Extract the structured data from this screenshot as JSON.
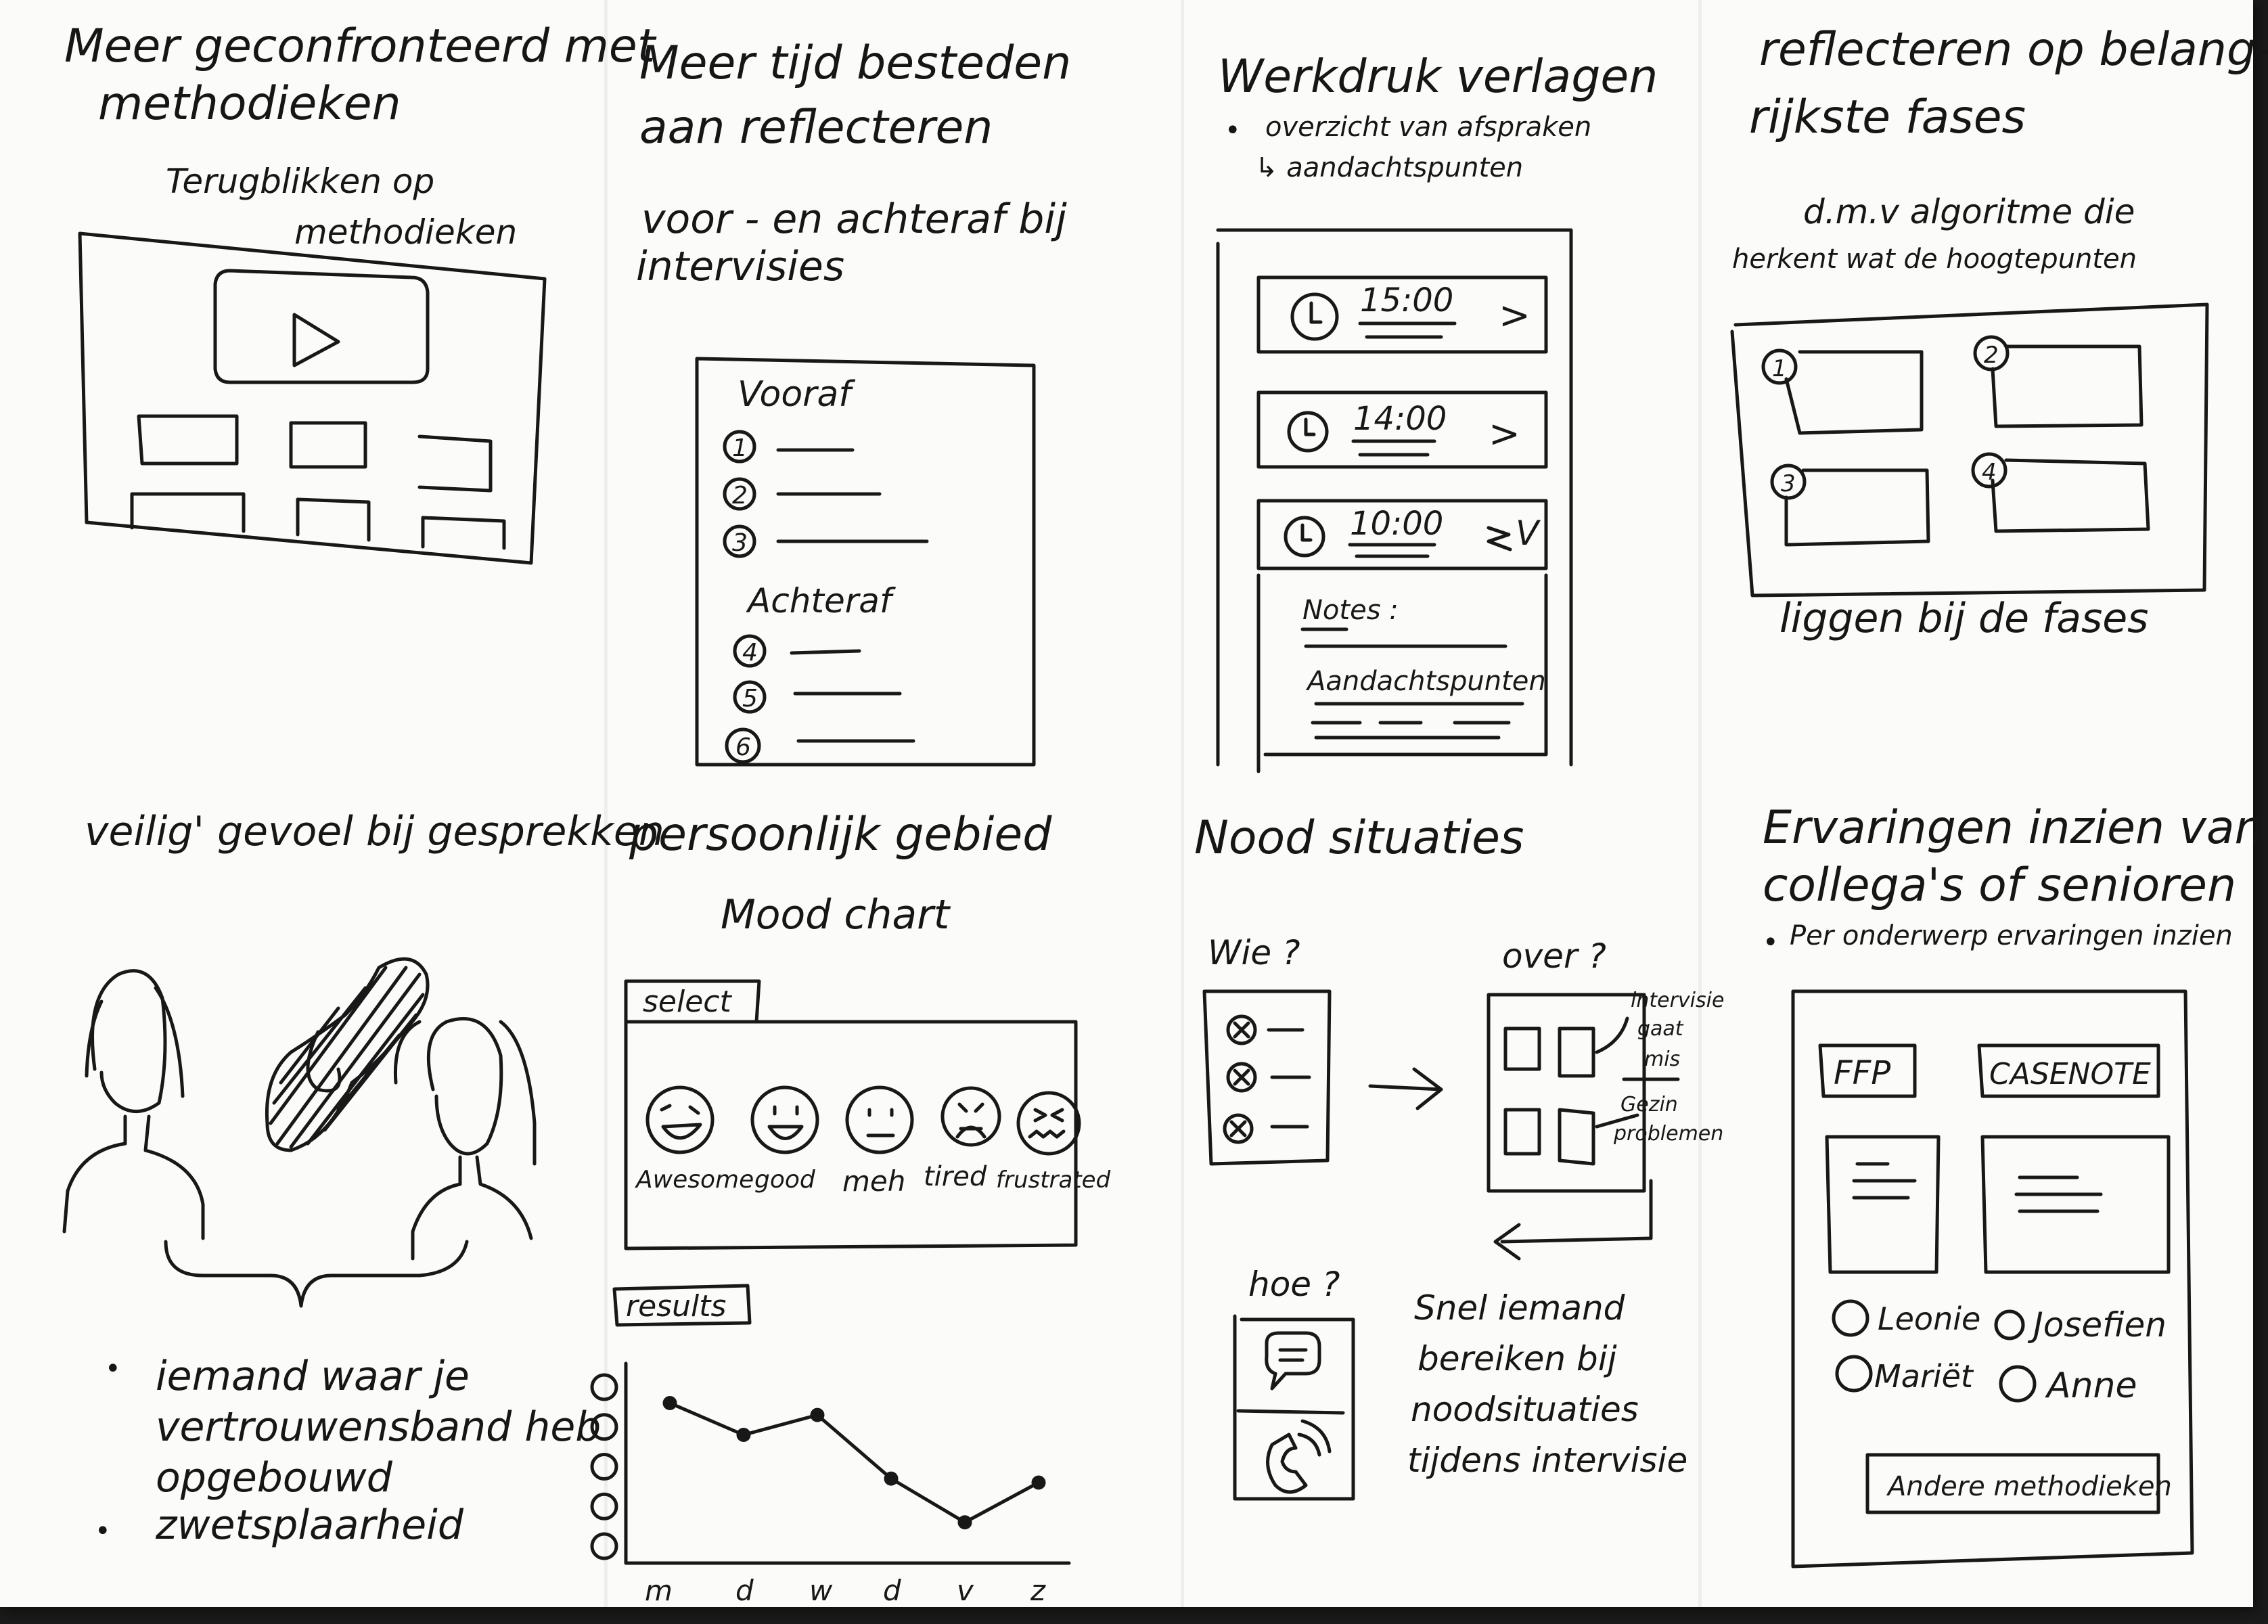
{
  "panels": {
    "p1": {
      "title_line1": "Meer geconfronteerd met",
      "title_line2": "methodieken",
      "subtitle_line1": "Terugblikken op",
      "subtitle_line2": "methodieken"
    },
    "p2": {
      "title_line1": "Meer tijd besteden",
      "title_line2": "aan reflecteren",
      "subtitle_line1": "voor - en achteraf bij",
      "subtitle_line2": "intervisies",
      "vooraf_label": "Vooraf",
      "achteraf_label": "Achteraf",
      "numbers": [
        "1",
        "2",
        "3",
        "4",
        "5",
        "6"
      ]
    },
    "p3": {
      "title": "Werkdruk verlagen",
      "bullet1": "overzicht van afspraken",
      "bullet2": "↳ aandachtspunten",
      "appointments": [
        {
          "time": "15:00",
          "status": ">"
        },
        {
          "time": "14:00",
          "status": ">"
        },
        {
          "time": "10:00",
          "status": "V"
        }
      ],
      "notes_label": "Notes :",
      "attention_label": "Aandachtspunten"
    },
    "p4": {
      "title_line1": "reflecteren op belang-",
      "title_line2": "rijkste fases",
      "sub_line1": "d.m.v algoritme die",
      "sub_line2": "herkent wat de hoogtepunten",
      "numbers": [
        "1",
        "2",
        "3",
        "4"
      ],
      "footer": "liggen bij de fases"
    },
    "p5": {
      "title": "veilig' gevoel bij gesprekken",
      "bullet1_line1": "iemand waar je",
      "bullet1_line2": "vertrouwensband heb",
      "bullet1_line3": "opgebouwd",
      "bullet2": "zwetsplaarheid"
    },
    "p6": {
      "title": "persoonlijk gebied",
      "subtitle": "Mood chart",
      "select_label": "select",
      "moods": [
        "Awesome",
        "good",
        "meh",
        "tired",
        "frustrated"
      ],
      "results_label": "results"
    },
    "p7": {
      "title": "Nood situaties",
      "wie_label": "Wie ?",
      "over_label": "over ?",
      "hoe_label": "hoe ?",
      "note1_line1": "intervisie",
      "note1_line2": "gaat",
      "note1_line3": "mis",
      "note2_line1": "Gezin",
      "note2_line2": "problemen",
      "body_line1": "Snel iemand",
      "body_line2": "bereiken bij",
      "body_line3": "noodsituaties",
      "body_line4": "tijdens intervisie"
    },
    "p8": {
      "title_line1": "Ervaringen inzien van",
      "title_line2": "collega's of senioren",
      "bullet": "Per onderwerp ervaringen inzien",
      "tab1": "FFP",
      "tab2": "CASENOTE",
      "names": [
        "Leonie",
        "Josefien",
        "Mariët",
        "Anne"
      ],
      "button": "Andere methodieken"
    }
  },
  "chart_data": {
    "type": "line",
    "title": "results",
    "categories": [
      "m",
      "d",
      "w",
      "d",
      "v",
      "z"
    ],
    "y_axis_icons": [
      "awesome-face",
      "good-face",
      "meh-face",
      "tired-face",
      "frustrated-face"
    ],
    "ylim": [
      1,
      5
    ],
    "series": [
      {
        "values": [
          4.6,
          3.8,
          4.3,
          2.7,
          1.6,
          2.6
        ]
      }
    ]
  }
}
